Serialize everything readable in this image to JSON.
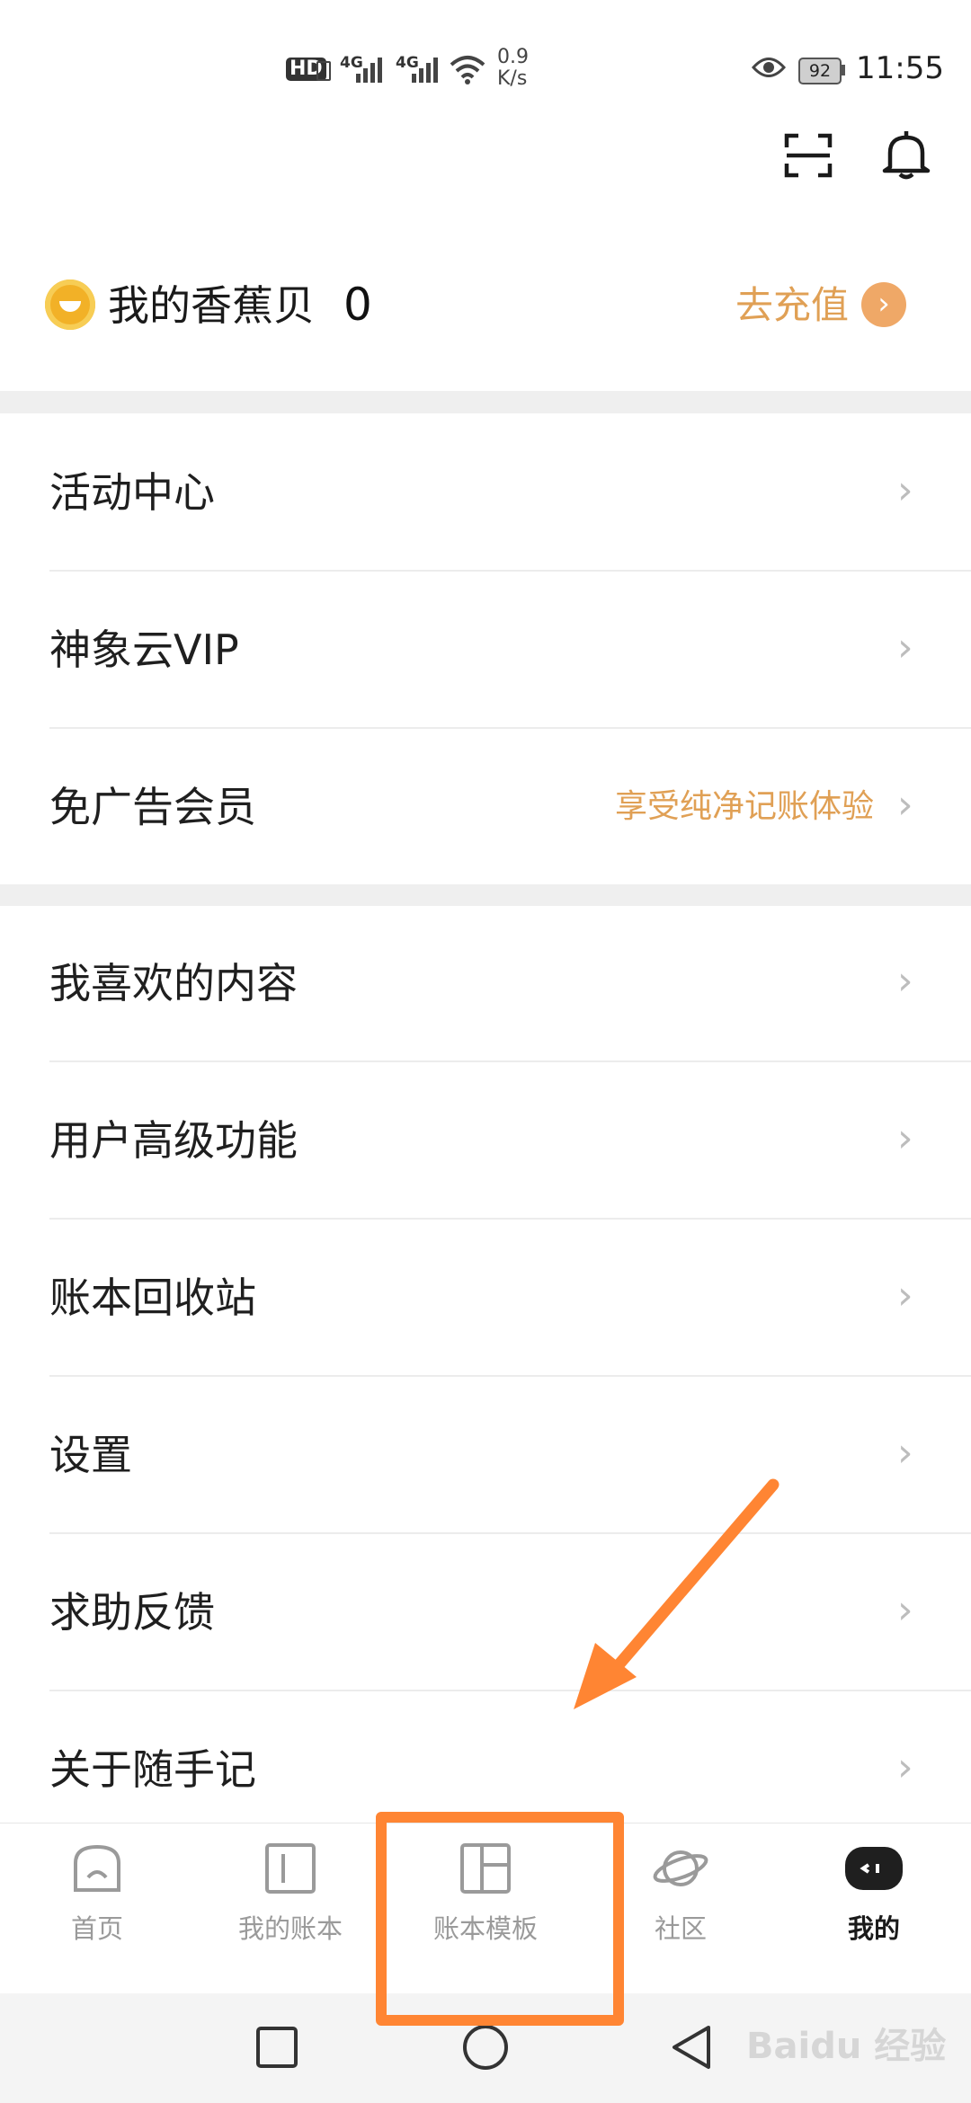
{
  "status_bar": {
    "hd": "HD",
    "net1": "4G",
    "net2": "4G",
    "speed_value": "0.9",
    "speed_unit": "K/s",
    "battery": "92",
    "time": "11:55"
  },
  "header": {
    "icons": [
      "scan-icon",
      "bell-icon"
    ],
    "beans_label": "我的香蕉贝",
    "beans_value": "0",
    "recharge_label": "去充值"
  },
  "section1": [
    {
      "label": "活动中心",
      "sub": ""
    },
    {
      "label": "神象云VIP",
      "sub": ""
    },
    {
      "label": "免广告会员",
      "sub": "享受纯净记账体验"
    }
  ],
  "section2": [
    {
      "label": "我喜欢的内容"
    },
    {
      "label": "用户高级功能"
    },
    {
      "label": "账本回收站"
    },
    {
      "label": "设置"
    },
    {
      "label": "求助反馈"
    },
    {
      "label": "关于随手记"
    }
  ],
  "tabs": [
    {
      "label": "首页",
      "icon": "home-icon",
      "active": false
    },
    {
      "label": "我的账本",
      "icon": "ledger-icon",
      "active": false
    },
    {
      "label": "账本模板",
      "icon": "template-icon",
      "active": false
    },
    {
      "label": "社区",
      "icon": "planet-icon",
      "active": false
    },
    {
      "label": "我的",
      "icon": "profile-icon",
      "active": true
    }
  ],
  "system_nav": [
    "recent-apps-icon",
    "home-circle-icon",
    "back-icon"
  ],
  "colors": {
    "accent": "#e0a055",
    "annotation": "#ff8533",
    "background": "#efefef"
  },
  "watermark": "Baidu 经验"
}
